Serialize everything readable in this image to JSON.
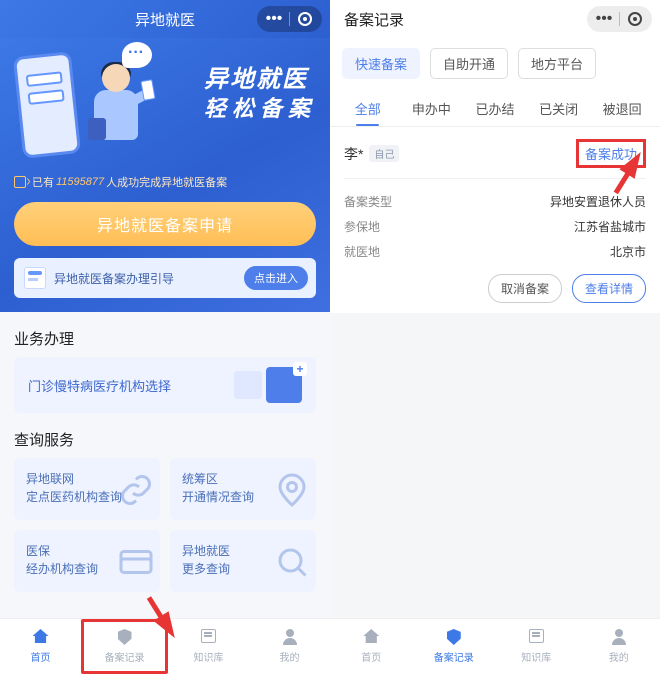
{
  "left": {
    "header": {
      "title": "异地就医"
    },
    "banner": {
      "slogan_l1": "异地就医",
      "slogan_l2": "轻松备案",
      "count_prefix": "已有",
      "count_num": "11595877",
      "count_suffix": "人成功完成异地就医备案"
    },
    "apply_btn": "异地就医备案申请",
    "guide": {
      "text": "异地就医备案办理引导",
      "btn": "点击进入"
    },
    "biz_title": "业务办理",
    "biz_card": "门诊慢特病医疗机构选择",
    "query_title": "查询服务",
    "query": [
      {
        "l1": "异地联网",
        "l2": "定点医药机构查询"
      },
      {
        "l1": "统筹区",
        "l2": "开通情况查询"
      },
      {
        "l1": "医保",
        "l2": "经办机构查询"
      },
      {
        "l1": "异地就医",
        "l2": "更多查询"
      }
    ],
    "tabs": [
      "首页",
      "备案记录",
      "知识库",
      "我的"
    ]
  },
  "right": {
    "header": {
      "title": "备案记录"
    },
    "filters": [
      "快速备案",
      "自助开通",
      "地方平台"
    ],
    "tabs2": [
      "全部",
      "申办中",
      "已办结",
      "已关闭",
      "被退回"
    ],
    "record": {
      "name": "李*",
      "self_tag": "自己",
      "status": "备案成功",
      "rows": [
        {
          "k": "备案类型",
          "v": "异地安置退休人员"
        },
        {
          "k": "参保地",
          "v": "江苏省盐城市"
        },
        {
          "k": "就医地",
          "v": "北京市"
        }
      ],
      "actions": {
        "cancel": "取消备案",
        "detail": "查看详情"
      }
    },
    "tabs": [
      "首页",
      "备案记录",
      "知识库",
      "我的"
    ]
  }
}
